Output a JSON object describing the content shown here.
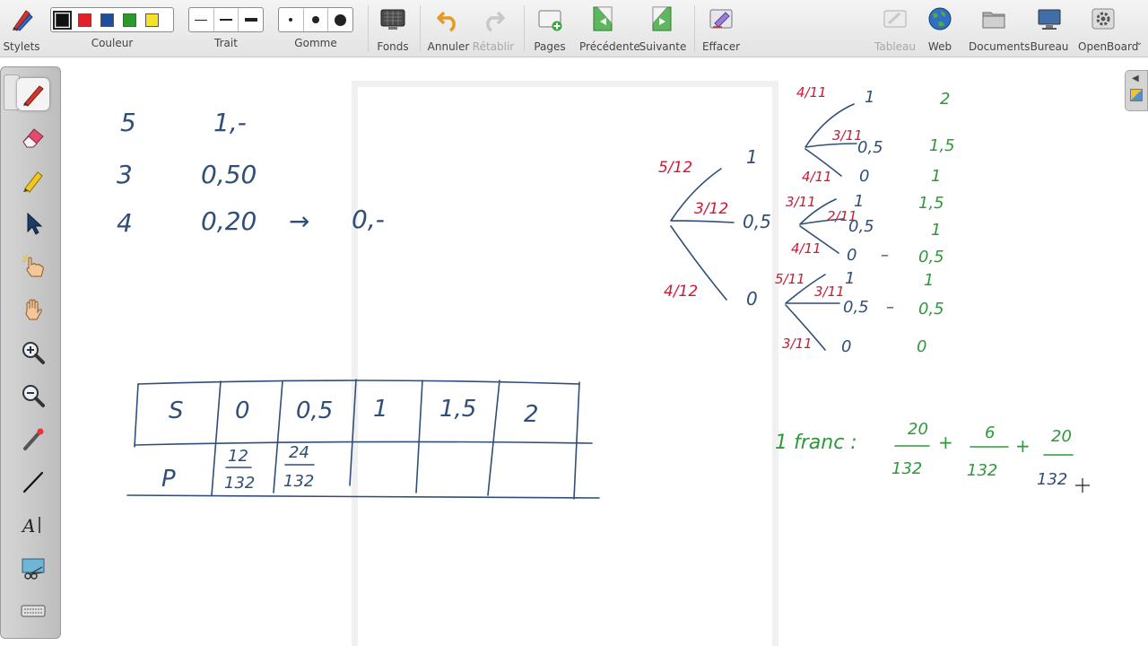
{
  "toolbar": {
    "styluses_label": "Stylets",
    "color_label": "Couleur",
    "colors": [
      "#111111",
      "#e3202a",
      "#1d4f9c",
      "#2a9a2a",
      "#f5e12a"
    ],
    "stroke_label": "Trait",
    "eraser_label": "Gomme",
    "backgrounds_label": "Fonds",
    "undo_label": "Annuler",
    "redo_label": "Rétablir",
    "pages_label": "Pages",
    "previous_label": "Précédente",
    "next_label": "Suivante",
    "clear_label": "Effacer",
    "board_label": "Tableau",
    "web_label": "Web",
    "documents_label": "Documents",
    "desktop_label": "Bureau",
    "app_label": "OpenBoard"
  },
  "board": {
    "top_left_list": {
      "rows": [
        {
          "count": "5",
          "value": "1,-"
        },
        {
          "count": "3",
          "value": "0,50"
        },
        {
          "count": "4",
          "value": "0,20",
          "arrow": "→",
          "result": "0,-"
        }
      ]
    },
    "table": {
      "headers": [
        "S",
        "0",
        "0,5",
        "1",
        "1,5",
        "2"
      ],
      "row_label": "P",
      "probabilities": [
        {
          "num": "12",
          "den": "132"
        },
        {
          "num": "24",
          "den": "132"
        }
      ]
    },
    "tree": {
      "first_branches": [
        {
          "prob": "5/12",
          "value": "1"
        },
        {
          "prob": "3/12",
          "value": "0,5"
        },
        {
          "prob": "4/12",
          "value": "0"
        }
      ],
      "second_groups": [
        {
          "branches": [
            {
              "prob": "4/11",
              "value": "1",
              "total": "2"
            },
            {
              "prob": "3/11",
              "value": "0,5",
              "total": "1,5"
            },
            {
              "prob": "4/11",
              "value": "0",
              "total": "1"
            }
          ]
        },
        {
          "branches": [
            {
              "prob": "3/11",
              "value": "1",
              "total": "1,5"
            },
            {
              "prob": "2/11",
              "value": "0,5",
              "total": "1"
            },
            {
              "prob": "4/11",
              "value": "0",
              "dash": "–",
              "total": "0,5"
            }
          ]
        },
        {
          "branches": [
            {
              "prob": "5/11",
              "value": "1",
              "total": "1"
            },
            {
              "prob": "3/11",
              "value": "0,5",
              "dash": "–",
              "total": "0,5"
            },
            {
              "prob": "3/11",
              "value": "0",
              "total": "0"
            }
          ]
        }
      ]
    },
    "formula": {
      "label": "1 franc :",
      "terms": [
        {
          "num": "20",
          "den": "132"
        },
        {
          "num": "6",
          "den": "132"
        },
        {
          "num": "20",
          "den": "132"
        }
      ],
      "plus": "+"
    }
  }
}
